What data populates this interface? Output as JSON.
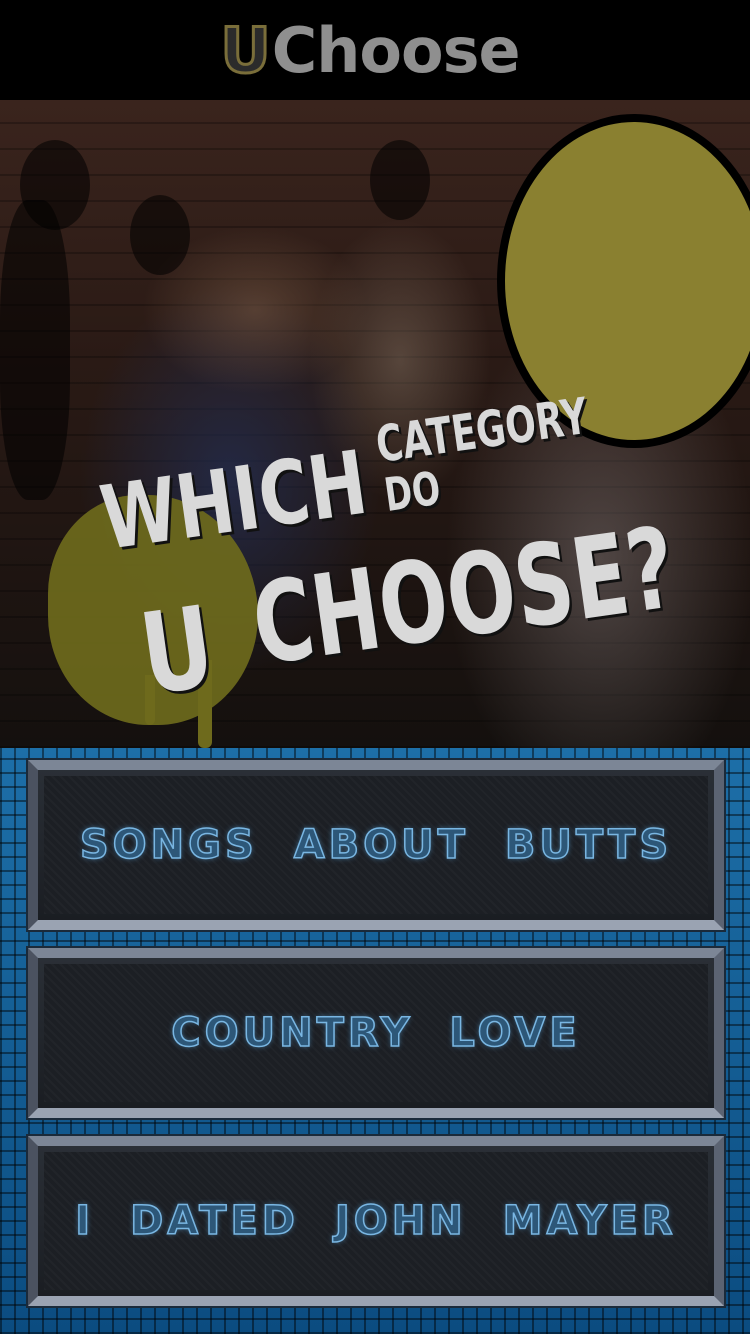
{
  "header": {
    "logo_u": "U",
    "logo_rest": "Choose"
  },
  "hero": {
    "headline": {
      "which": "WHICH",
      "category": "CATEGORY",
      "do": "DO",
      "u": "U",
      "choose": "CHOOSE?"
    }
  },
  "options": [
    {
      "label": "SONGS ABOUT BUTTS"
    },
    {
      "label": "COUNTRY LOVE"
    },
    {
      "label": "I DATED JOHN MAYER"
    }
  ],
  "colors": {
    "accent_olive": "#8a8030",
    "panel_blue": "#1d6fa8",
    "option_text": "#79b6e2"
  }
}
